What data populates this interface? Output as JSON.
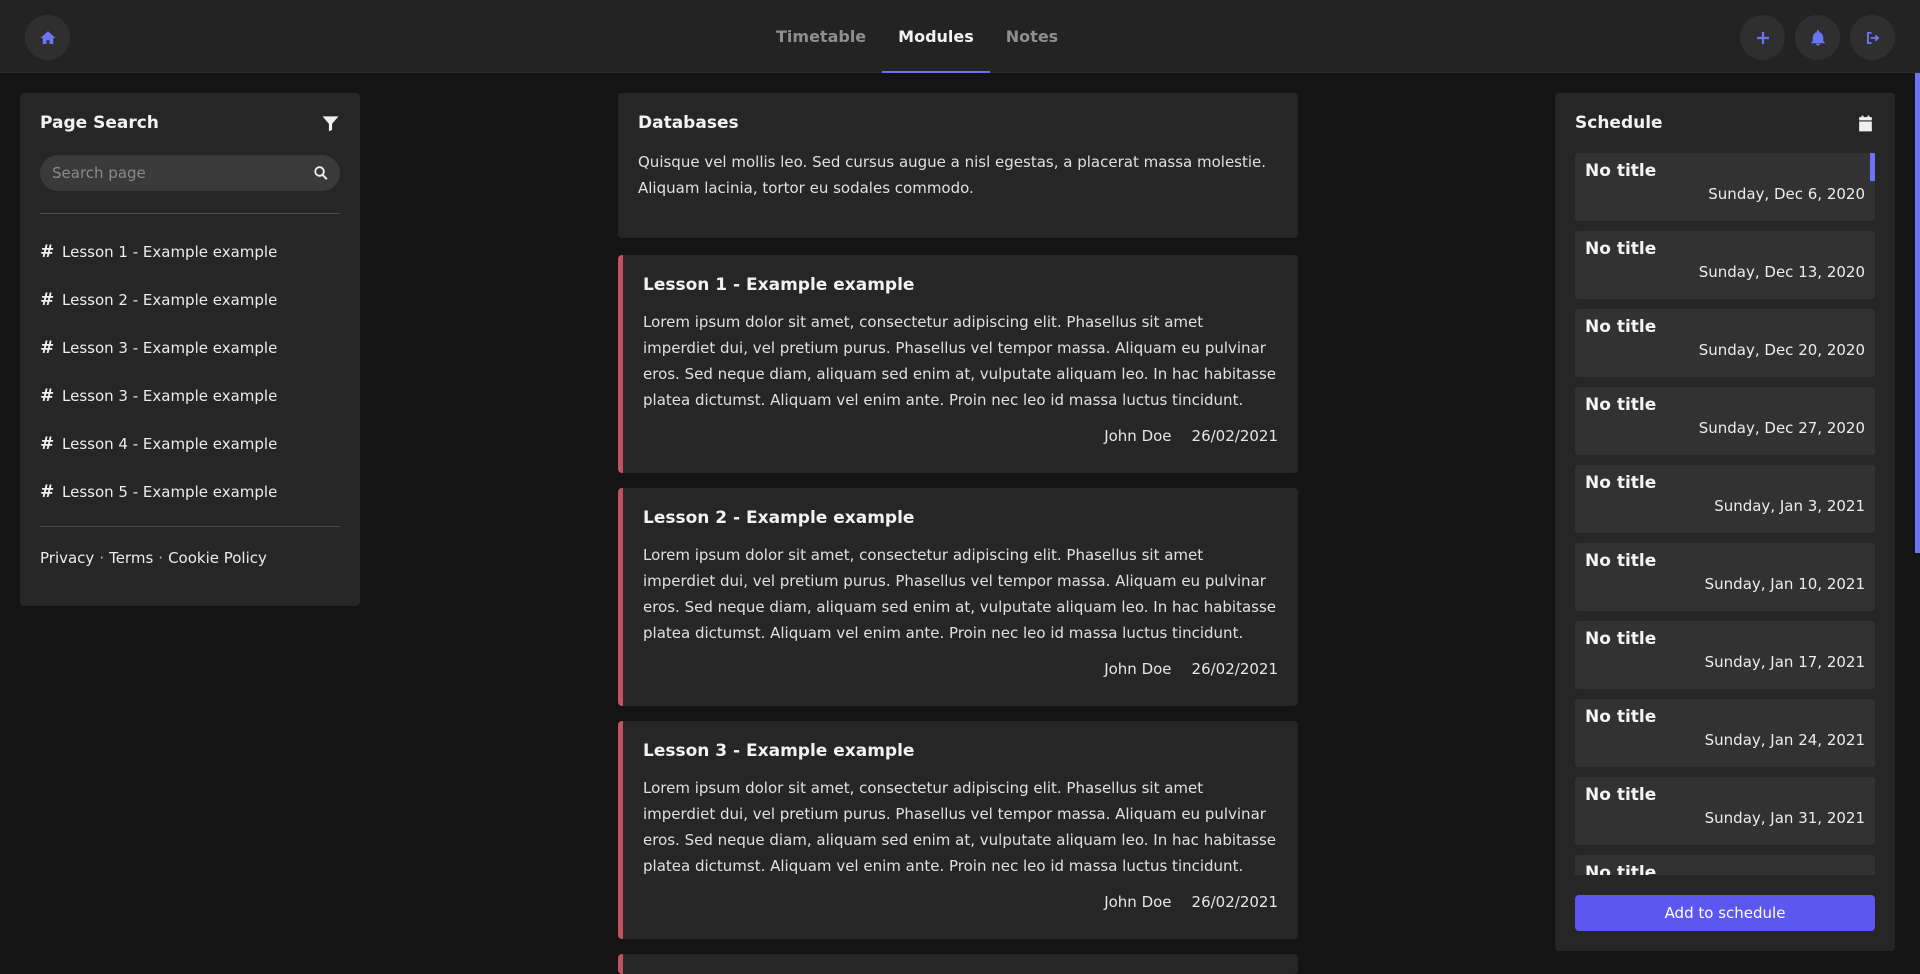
{
  "nav": {
    "tabs": [
      {
        "label": "Timetable"
      },
      {
        "label": "Modules"
      },
      {
        "label": "Notes"
      }
    ],
    "active_tab": "Modules"
  },
  "colors": {
    "accent": "#6b74f2",
    "lesson_border": "#c2525d",
    "button": "#5b57f0"
  },
  "left_panel": {
    "title": "Page Search",
    "search_placeholder": "Search page",
    "links": [
      {
        "label": "Lesson 1 - Example example"
      },
      {
        "label": "Lesson 2 - Example example"
      },
      {
        "label": "Lesson 3 - Example example"
      },
      {
        "label": "Lesson 3 - Example example"
      },
      {
        "label": "Lesson 4 - Example example"
      },
      {
        "label": "Lesson 5 - Example example"
      }
    ],
    "footer": {
      "privacy": "Privacy",
      "sep": "·",
      "terms": "Terms",
      "cookie": "Cookie Policy"
    }
  },
  "module": {
    "title": "Databases",
    "description": "Quisque vel mollis leo. Sed cursus augue a nisl egestas, a placerat massa molestie. Aliquam lacinia, tortor eu sodales commodo."
  },
  "lessons": [
    {
      "title": "Lesson 1 - Example example",
      "body": "Lorem ipsum dolor sit amet, consectetur adipiscing elit. Phasellus sit amet imperdiet dui, vel pretium purus. Phasellus vel tempor massa. Aliquam eu pulvinar eros. Sed neque diam, aliquam sed enim at, vulputate aliquam leo. In hac habitasse platea dictumst. Aliquam vel enim ante. Proin nec leo id massa luctus tincidunt.",
      "author": "John Doe",
      "date": "26/02/2021"
    },
    {
      "title": "Lesson 2 - Example example",
      "body": "Lorem ipsum dolor sit amet, consectetur adipiscing elit. Phasellus sit amet imperdiet dui, vel pretium purus. Phasellus vel tempor massa. Aliquam eu pulvinar eros. Sed neque diam, aliquam sed enim at, vulputate aliquam leo. In hac habitasse platea dictumst. Aliquam vel enim ante. Proin nec leo id massa luctus tincidunt.",
      "author": "John Doe",
      "date": "26/02/2021"
    },
    {
      "title": "Lesson 3 - Example example",
      "body": "Lorem ipsum dolor sit amet, consectetur adipiscing elit. Phasellus sit amet imperdiet dui, vel pretium purus. Phasellus vel tempor massa. Aliquam eu pulvinar eros. Sed neque diam, aliquam sed enim at, vulputate aliquam leo. In hac habitasse platea dictumst. Aliquam vel enim ante. Proin nec leo id massa luctus tincidunt.",
      "author": "John Doe",
      "date": "26/02/2021"
    }
  ],
  "schedule": {
    "title": "Schedule",
    "items": [
      {
        "title": "No title",
        "date": "Sunday, Dec 6, 2020"
      },
      {
        "title": "No title",
        "date": "Sunday, Dec 13, 2020"
      },
      {
        "title": "No title",
        "date": "Sunday, Dec 20, 2020"
      },
      {
        "title": "No title",
        "date": "Sunday, Dec 27, 2020"
      },
      {
        "title": "No title",
        "date": "Sunday, Jan 3, 2021"
      },
      {
        "title": "No title",
        "date": "Sunday, Jan 10, 2021"
      },
      {
        "title": "No title",
        "date": "Sunday, Jan 17, 2021"
      },
      {
        "title": "No title",
        "date": "Sunday, Jan 24, 2021"
      },
      {
        "title": "No title",
        "date": "Sunday, Jan 31, 2021"
      },
      {
        "title": "No title",
        "date": ""
      }
    ],
    "add_label": "Add to schedule"
  }
}
